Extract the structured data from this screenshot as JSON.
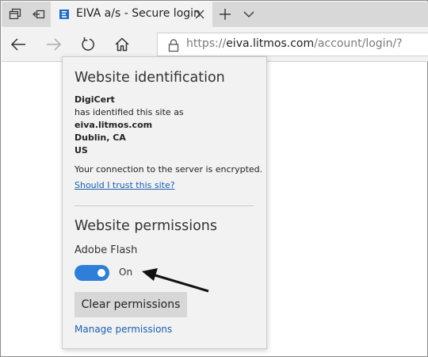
{
  "browser": {
    "tab": {
      "title": "EIVA a/s - Secure login"
    },
    "address_bar": {
      "url_prefix": "https://",
      "url_host": "eiva.litmos.com",
      "url_path": "/account/login/?"
    }
  },
  "flyout": {
    "identification": {
      "heading": "Website identification",
      "issuer": "DigiCert",
      "identified_text": "has identified this site as",
      "site": "eiva.litmos.com",
      "city": "Dublin, CA",
      "country": "US",
      "connection_text": "Your connection to the server is encrypted.",
      "trust_link": "Should I trust this site?"
    },
    "permissions": {
      "heading": "Website permissions",
      "flash_label": "Adobe Flash",
      "flash_state": "On",
      "clear_button": "Clear permissions",
      "manage_link": "Manage permissions"
    }
  },
  "colors": {
    "accent": "#2f7fd8",
    "link": "#1a5fb0",
    "tabbar": "#d8d8d8",
    "panel": "#f2f2f2"
  },
  "icons": [
    "tab-manager-icon",
    "set-aside-tabs-icon",
    "edge-favicon-icon",
    "close-icon",
    "new-tab-icon",
    "chevron-down-icon",
    "back-arrow-icon",
    "forward-arrow-icon",
    "refresh-icon",
    "home-icon",
    "lock-icon",
    "annotation-arrow-icon"
  ]
}
